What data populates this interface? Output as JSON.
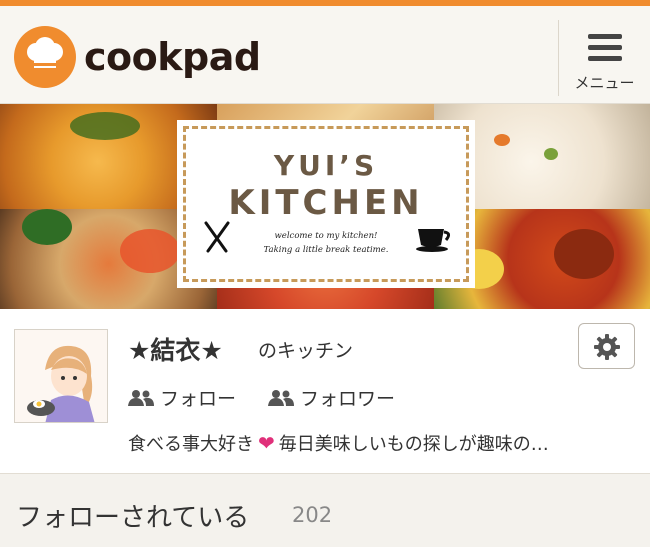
{
  "header": {
    "logo_text": "cookpad",
    "menu_label": "メニュー"
  },
  "banner": {
    "title_line1": "YUI’S",
    "title_line2": "KITCHEN",
    "subtitle_line1": "welcome to my kitchen!",
    "subtitle_line2": "Taking a little break teatime."
  },
  "profile": {
    "name": "★結衣★",
    "kitchen_suffix": "のキッチン",
    "follow_label": "フォロー",
    "follower_label": "フォロワー",
    "bio_before": "食べる事大好き",
    "bio_after": "毎日美味しいもの探しが趣味の…"
  },
  "section": {
    "title": "フォローされている",
    "count": "202"
  },
  "colors": {
    "brand_orange": "#f08c2e",
    "heart_pink": "#e0307a",
    "background": "#f4f2ed"
  },
  "icons": [
    "chef-hat-icon",
    "hamburger-menu-icon",
    "gear-icon",
    "users-icon",
    "heart-icon",
    "fork-icon",
    "teacup-icon"
  ]
}
